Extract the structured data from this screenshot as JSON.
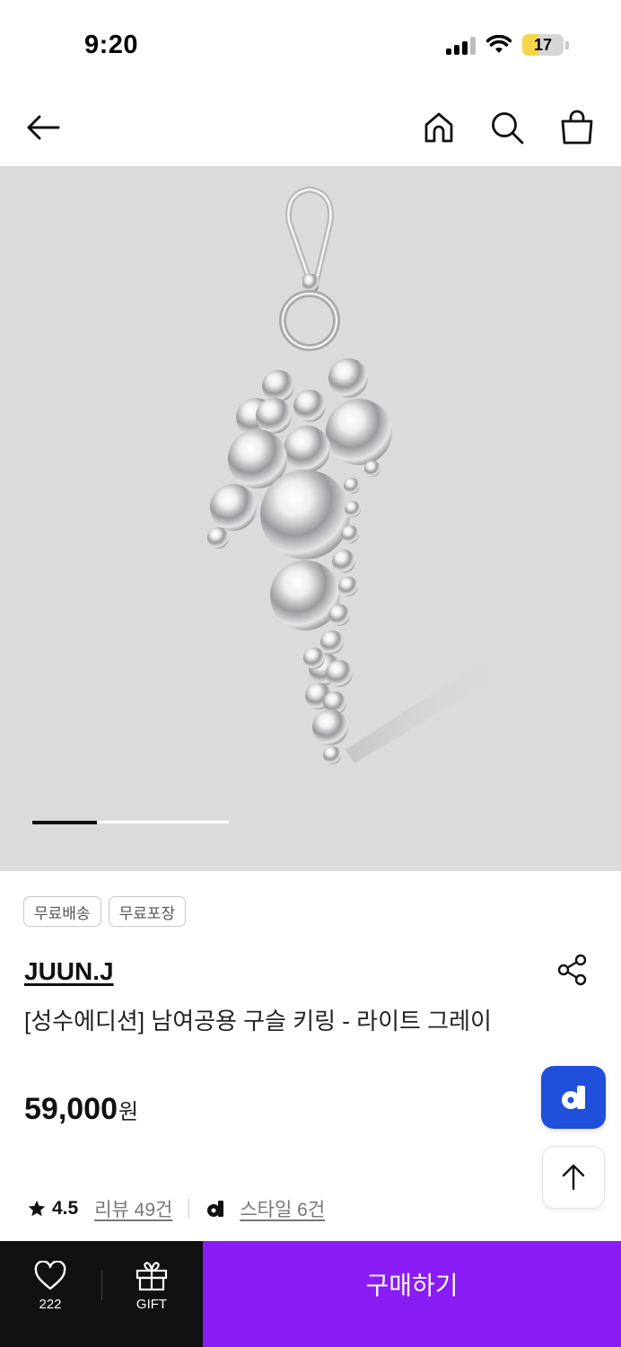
{
  "status": {
    "time": "9:20",
    "battery": "17"
  },
  "badges": [
    "무료배송",
    "무료포장"
  ],
  "product": {
    "brand": "JUUN.J",
    "title": "[성수에디션] 남여공용 구슬 키링 - 라이트 그레이",
    "price": "59,000",
    "price_unit": "원",
    "rating": "4.5",
    "reviews": "리뷰 49건",
    "styles": "스타일 6건"
  },
  "image_carousel": {
    "progress": 0.33
  },
  "bottom_bar": {
    "like_count": "222",
    "gift_label": "GIFT",
    "buy_label": "구매하기"
  },
  "colors": {
    "accent": "#8a1cf5",
    "float_button": "#1f4fdb",
    "image_bg": "#dbdbdd"
  },
  "icons": {
    "back": "arrow-left-icon",
    "home": "home-icon",
    "search": "search-icon",
    "cart": "shopping-bag-icon",
    "share": "share-icon",
    "scroll_top": "arrow-up-icon",
    "like": "heart-icon",
    "gift": "gift-icon"
  }
}
